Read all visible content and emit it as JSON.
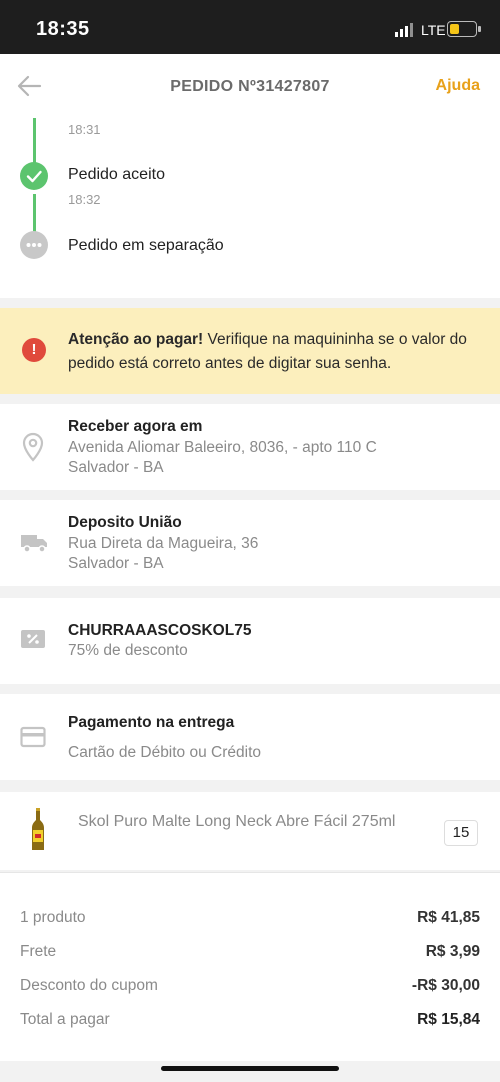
{
  "status_bar": {
    "time": "18:35",
    "network": "LTE"
  },
  "header": {
    "title": "PEDIDO Nº31427807",
    "help": "Ajuda"
  },
  "timeline": [
    {
      "time": "18:31"
    },
    {
      "label": "Pedido aceito",
      "time": "18:32",
      "state": "done"
    },
    {
      "label": "Pedido em separação",
      "state": "pending"
    }
  ],
  "alert": {
    "bold": "Atenção ao pagar!",
    "text": " Verifique na maquininha se o valor do pedido está correto antes de digitar sua senha."
  },
  "delivery": {
    "title": "Receber agora em",
    "line1": "Avenida Aliomar Baleeiro, 8036,  - apto 110 C",
    "line2": "Salvador - BA"
  },
  "store": {
    "title": "Deposito União",
    "line1": "Rua Direta da Magueira,  36",
    "line2": "Salvador - BA"
  },
  "coupon": {
    "code": "CHURRAAASCOSKOL75",
    "discount": "75% de desconto"
  },
  "payment": {
    "title": "Pagamento na entrega",
    "method": "Cartão de Débito ou Crédito"
  },
  "product": {
    "name": "Skol Puro Malte Long Neck Abre Fácil 275ml",
    "quantity": "15"
  },
  "totals": [
    {
      "label": "1 produto",
      "value": "R$ 41,85"
    },
    {
      "label": "Frete",
      "value": "R$ 3,99"
    },
    {
      "label": "Desconto do cupom",
      "value": "-R$ 30,00"
    },
    {
      "label": "Total a pagar",
      "value": "R$ 15,84"
    }
  ],
  "colors": {
    "accent": "#e8a11a",
    "success": "#5cc46e",
    "alert_bg": "#fcefbd",
    "alert_icon": "#e04a3c"
  }
}
